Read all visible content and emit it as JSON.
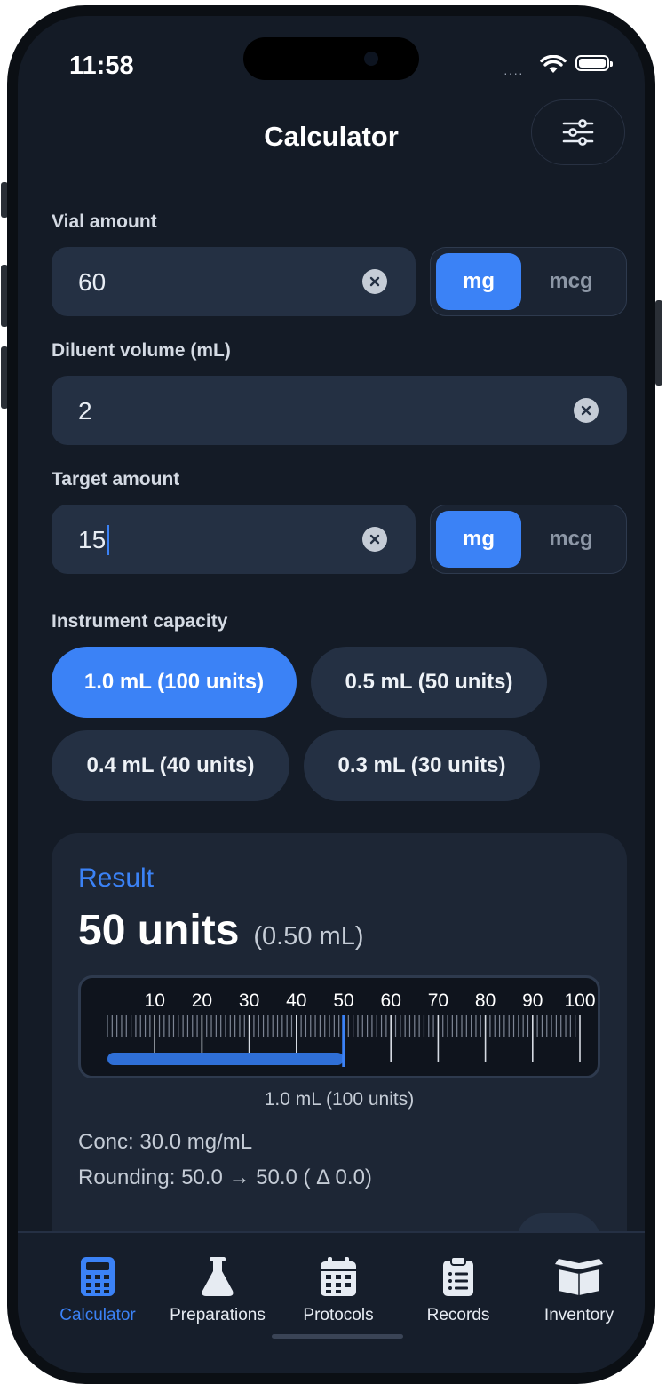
{
  "status": {
    "time": "11:58"
  },
  "header": {
    "title": "Calculator",
    "settings_icon": "sliders-icon"
  },
  "form": {
    "vial": {
      "label": "Vial amount",
      "value": "60",
      "units": [
        "mg",
        "mcg"
      ],
      "selected_unit": "mg"
    },
    "diluent": {
      "label": "Diluent volume (mL)",
      "value": "2"
    },
    "target": {
      "label": "Target amount",
      "value": "15",
      "units": [
        "mg",
        "mcg"
      ],
      "selected_unit": "mg"
    },
    "capacity": {
      "label": "Instrument capacity",
      "options": [
        "1.0 mL (100 units)",
        "0.5 mL (50 units)",
        "0.4 mL (40 units)",
        "0.3 mL (30 units)"
      ],
      "selected": "1.0 mL (100 units)"
    }
  },
  "result": {
    "label": "Result",
    "units_text": "50 units",
    "ml_text": "(0.50 mL)",
    "syringe": {
      "ticks": [
        "10",
        "20",
        "30",
        "40",
        "50",
        "60",
        "70",
        "80",
        "90",
        "100"
      ],
      "max": 100,
      "fill": 50,
      "capacity_label": "1.0 mL (100 units)"
    },
    "conc": "Conc: 30.0 mg/mL",
    "rounding": "Rounding: 50.0 → 50.0  ( Δ 0.0)"
  },
  "tabs": [
    {
      "label": "Calculator",
      "icon": "calculator-icon",
      "active": true
    },
    {
      "label": "Preparations",
      "icon": "flask-icon",
      "active": false
    },
    {
      "label": "Protocols",
      "icon": "calendar-icon",
      "active": false
    },
    {
      "label": "Records",
      "icon": "clipboard-icon",
      "active": false
    },
    {
      "label": "Inventory",
      "icon": "box-icon",
      "active": false
    }
  ],
  "colors": {
    "accent": "#3b82f6",
    "background": "#141b26",
    "field": "#243043",
    "card": "#1d2635"
  }
}
